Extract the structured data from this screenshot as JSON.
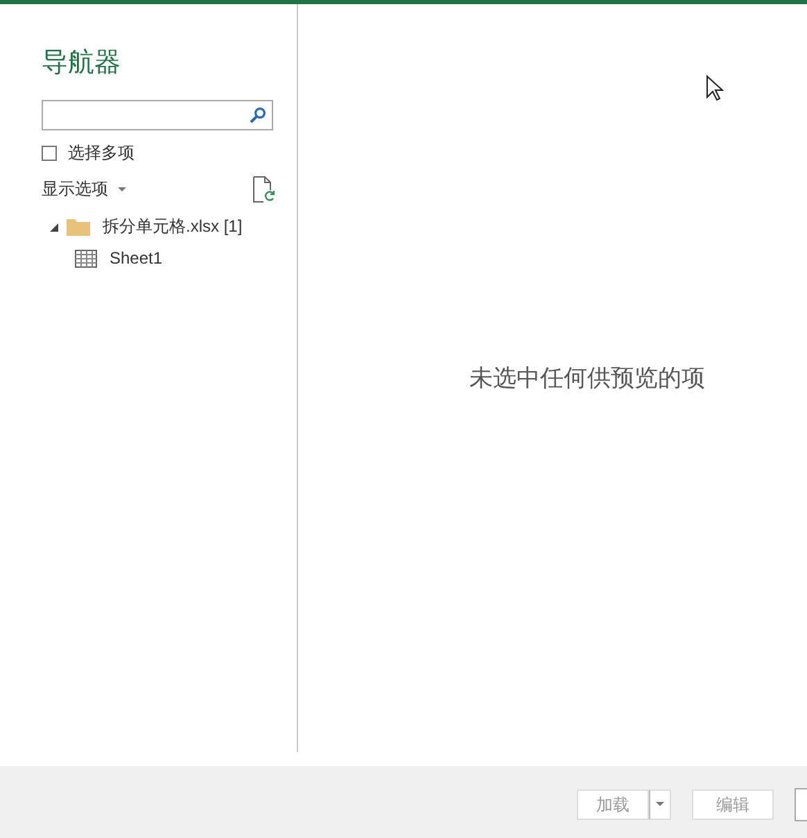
{
  "window": {
    "title": "导航器"
  },
  "select_multiple": {
    "label": "选择多项",
    "checked": false
  },
  "display_options": {
    "label": "显示选项"
  },
  "tree": [
    {
      "label": "拆分单元格.xlsx [1]",
      "kind": "folder",
      "expanded": true,
      "children": [
        {
          "label": "Sheet1",
          "kind": "sheet"
        }
      ]
    }
  ],
  "preview": {
    "message": "未选中任何供预览的项"
  },
  "buttons": [
    {
      "label": "加载",
      "kind": "split",
      "disabled": true
    },
    {
      "label": "编辑",
      "kind": "plain",
      "disabled": true
    }
  ]
}
